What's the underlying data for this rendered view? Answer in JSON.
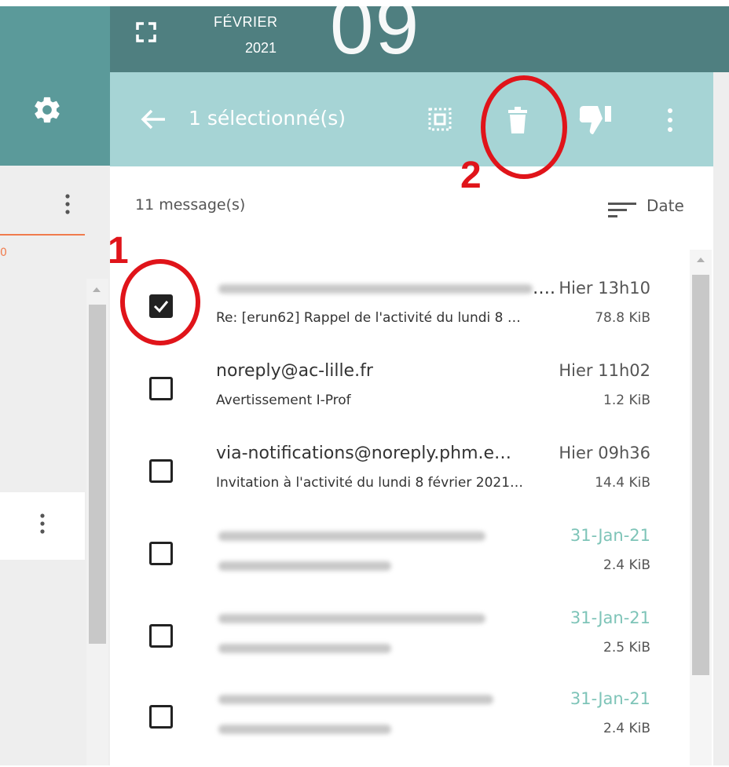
{
  "header": {
    "month": "FÉVRIER",
    "year": "2021",
    "day": "09"
  },
  "selection_bar": {
    "selected_text": "1 sélectionné(s)"
  },
  "list": {
    "count": "11 message(s)",
    "sort_label": "Date",
    "messages": [
      {
        "from": "…. ",
        "subject": "Re: [erun62] Rappel de l'activité du lundi 8 …",
        "date": "Hier 13h10",
        "size": "78.8 KiB",
        "checked": true
      },
      {
        "from": "noreply@ac-lille.fr",
        "subject": "Avertissement I-Prof",
        "date": "Hier 11h02",
        "size": "1.2 KiB",
        "checked": false
      },
      {
        "from": "via-notifications@noreply.phm.e…",
        "subject": "Invitation à l'activité du lundi 8 février 2021…",
        "date": "Hier 09h36",
        "size": "14.4 KiB",
        "checked": false
      },
      {
        "from": "",
        "subject": "",
        "date": "31-Jan-21",
        "size": "2.4 KiB",
        "checked": false
      },
      {
        "from": "",
        "subject": "",
        "date": "31-Jan-21",
        "size": "2.5 KiB",
        "checked": false
      },
      {
        "from": "",
        "subject": "",
        "date": "31-Jan-21",
        "size": "2.4 KiB",
        "checked": false
      }
    ]
  },
  "left_panel": {
    "orange_fragment": "0"
  },
  "annotations": {
    "step1": "1",
    "step2": "2"
  },
  "colors": {
    "header": "#4f7f80",
    "selection_bar": "#a6d4d5",
    "sidebar": "#5b9a9a",
    "annotation": "#e0141a",
    "old_date": "#7ec4b8"
  },
  "icons": [
    "gear-icon",
    "expand-icon",
    "back-arrow-icon",
    "select-all-icon",
    "trash-icon",
    "thumbs-down-icon",
    "more-vert-icon",
    "sort-icon",
    "checkbox-icon"
  ]
}
